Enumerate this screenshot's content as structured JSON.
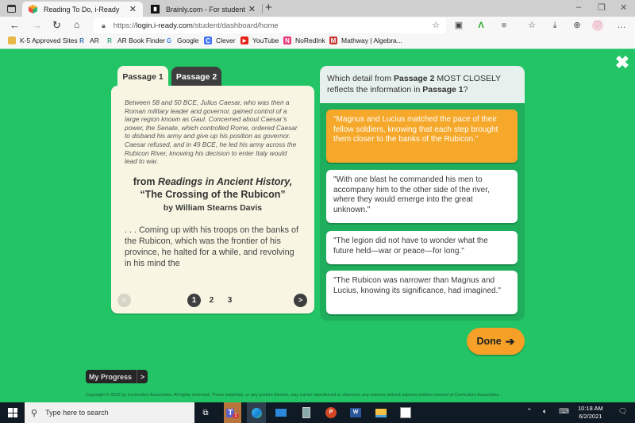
{
  "browser": {
    "tabs": [
      {
        "title": "Reading To Do, i-Ready",
        "active": true
      },
      {
        "title": "Brainly.com - For students. By stu",
        "active": false
      }
    ],
    "url_prefix": "https://",
    "url_host": "login.i-ready.com",
    "url_path": "/student/dashboard/home",
    "window_controls": {
      "minimize": "–",
      "restore": "❐",
      "close": "✕"
    },
    "bookmarks": [
      {
        "label": "K-5 Approved Sites",
        "icon": "folder-icon",
        "color": "#e8b84a"
      },
      {
        "label": "AR",
        "icon": "ar-icon",
        "color": "#3b6fb6"
      },
      {
        "label": "AR Book Finder",
        "icon": "ar-book-finder-icon",
        "color": "#3aa57a"
      },
      {
        "label": "Google",
        "icon": "google-icon",
        "color": "#4285f4"
      },
      {
        "label": "Clever",
        "icon": "clever-icon",
        "color": "#4274f6"
      },
      {
        "label": "YouTube",
        "icon": "youtube-icon",
        "color": "#e62117"
      },
      {
        "label": "NoRedInk",
        "icon": "noredink-icon",
        "color": "#e8357a"
      },
      {
        "label": "Mathway | Algebra...",
        "icon": "mathway-icon",
        "color": "#c8332f"
      }
    ]
  },
  "lesson": {
    "close_symbol": "✖",
    "passage_tabs": [
      {
        "label": "Passage 1",
        "active": true
      },
      {
        "label": "Passage 2",
        "active": false
      }
    ],
    "passage": {
      "intro": "Between 58 and 50 BCE, Julius Caesar, who was then a Roman military leader and governor, gained control of a large region known as Gaul. Concerned about Caesar’s power, the Senate, which controlled Rome, ordered Caesar to disband his army and give up his position as governor. Caesar refused, and in 49 BCE, he led his army across the Rubicon River, knowing his decision to enter Italy would lead to war.",
      "source_prefix": "from ",
      "source_book": "Readings in Ancient History,",
      "source_title": "“The Crossing of the Rubicon”",
      "source_author": "by William Stearns Davis",
      "body": ". . . Coming up with his troops on the banks of the Rubicon, which was the frontier of his province, he halted for a while, and revolving in his mind the"
    },
    "pagination": {
      "prev_symbol": "<",
      "next_symbol": ">",
      "pages": [
        "1",
        "2",
        "3"
      ],
      "current_page": 1
    },
    "question": {
      "prefix": "Which detail from ",
      "bold1": "Passage 2",
      "middle": " MOST CLOSELY reflects the information in ",
      "bold2": "Passage 1",
      "suffix": "?"
    },
    "choices": [
      {
        "text": "\"Magnus and Lucius matched the pace of their fellow soldiers, knowing that each step brought them closer to the banks of the Rubicon.\"",
        "selected": true
      },
      {
        "text": "\"With one blast he commanded his men to accompany him to the other side of the river, where they would emerge into the great unknown.\"",
        "selected": false
      },
      {
        "text": "\"The legion did not have to wonder what the future held—war or peace—for long.\"",
        "selected": false
      },
      {
        "text": "\"The Rubicon was narrower than Magnus and Lucius, knowing its significance, had imagined.\"",
        "selected": false
      }
    ],
    "done_label": "Done",
    "done_arrow": "➔",
    "my_progress_label": "My Progress",
    "my_progress_chevron": ">",
    "copyright": "Copyright © 2021 by Curriculum Associates. All rights reserved. These materials, or any portion thereof, may not be reproduced or shared in any manner without express written consent of Curriculum Associates.",
    "colors": {
      "background": "#22c466",
      "passage_bg": "#f8f6e3",
      "selected_choice": "#f6a82a",
      "done_button": "#f6a027",
      "dark_tab": "#3e3e3e"
    }
  },
  "taskbar": {
    "search_placeholder": "Type here to search",
    "time": "10:18 AM",
    "date": "6/2/2021",
    "teams_badge": "1"
  }
}
